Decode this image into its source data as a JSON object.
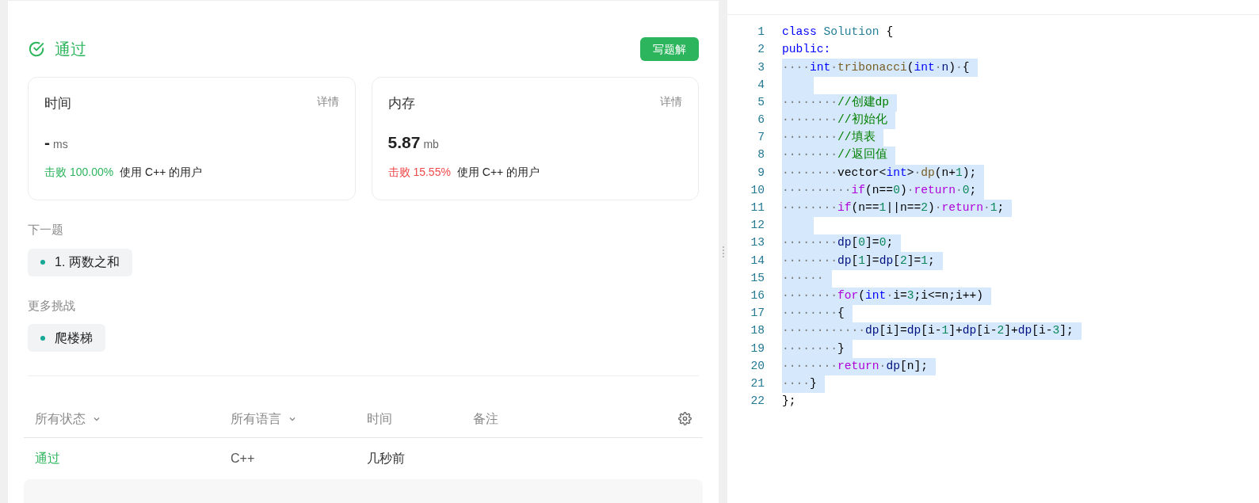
{
  "result": {
    "status": "通过",
    "button": "写题解"
  },
  "stats": [
    {
      "title": "时间",
      "link": "详情",
      "value": "-",
      "unit": "ms",
      "beat": "击败 100.00%",
      "beat_good": true,
      "note": "使用 C++ 的用户"
    },
    {
      "title": "内存",
      "link": "详情",
      "value": "5.87",
      "unit": "mb",
      "beat": "击败 15.55%",
      "beat_good": false,
      "note": "使用 C++ 的用户"
    }
  ],
  "next": {
    "heading": "下一题",
    "items": [
      "1. 两数之和"
    ]
  },
  "more": {
    "heading": "更多挑战",
    "items": [
      "爬楼梯"
    ]
  },
  "table": {
    "columns": [
      {
        "label": "所有状态",
        "dropdown": true
      },
      {
        "label": "所有语言",
        "dropdown": true
      },
      {
        "label": "时间",
        "dropdown": false
      },
      {
        "label": "备注",
        "dropdown": false
      }
    ],
    "rows": [
      {
        "status": "通过",
        "language": "C++",
        "time": "几秒前"
      }
    ]
  },
  "code": [
    {
      "number": "1",
      "selected": false,
      "tokens": [
        {
          "kind": "keyword",
          "text": "class"
        },
        {
          "kind": "type",
          "text": " Solution"
        },
        {
          "kind": "plain",
          "text": " {"
        }
      ]
    },
    {
      "number": "2",
      "selected": false,
      "tokens": [
        {
          "kind": "keyword",
          "text": "public:"
        }
      ]
    },
    {
      "number": "3",
      "selected": true,
      "tokens": [
        {
          "kind": "ws",
          "text": "····"
        },
        {
          "kind": "keyword",
          "text": "int"
        },
        {
          "kind": "ws",
          "text": "·"
        },
        {
          "kind": "func",
          "text": "tribonacci"
        },
        {
          "kind": "plain",
          "text": "("
        },
        {
          "kind": "keyword",
          "text": "int"
        },
        {
          "kind": "ws",
          "text": "·"
        },
        {
          "kind": "var",
          "text": "n"
        },
        {
          "kind": "plain",
          "text": ")"
        },
        {
          "kind": "ws",
          "text": "·"
        },
        {
          "kind": "plain",
          "text": "{"
        }
      ]
    },
    {
      "number": "4",
      "selected": true
    },
    {
      "number": "5",
      "selected": true,
      "tokens": [
        {
          "kind": "ws",
          "text": "········"
        },
        {
          "kind": "comment",
          "text": "//创建dp"
        }
      ]
    },
    {
      "number": "6",
      "selected": true,
      "tokens": [
        {
          "kind": "ws",
          "text": "········"
        },
        {
          "kind": "comment",
          "text": "//初始化"
        }
      ]
    },
    {
      "number": "7",
      "selected": true,
      "tokens": [
        {
          "kind": "ws",
          "text": "········"
        },
        {
          "kind": "comment",
          "text": "//填表"
        }
      ]
    },
    {
      "number": "8",
      "selected": true,
      "tokens": [
        {
          "kind": "ws",
          "text": "········"
        },
        {
          "kind": "comment",
          "text": "//返回值"
        }
      ]
    },
    {
      "number": "9",
      "selected": true,
      "tokens": [
        {
          "kind": "ws",
          "text": "········"
        },
        {
          "kind": "plain",
          "text": "vector<"
        },
        {
          "kind": "keyword",
          "text": "int"
        },
        {
          "kind": "plain",
          "text": ">"
        },
        {
          "kind": "ws",
          "text": "·"
        },
        {
          "kind": "func",
          "text": "dp"
        },
        {
          "kind": "plain",
          "text": "(n+"
        },
        {
          "kind": "number",
          "text": "1"
        },
        {
          "kind": "plain",
          "text": ");"
        }
      ]
    },
    {
      "number": "10",
      "selected": true,
      "tokens": [
        {
          "kind": "ws",
          "text": "··········"
        },
        {
          "kind": "control",
          "text": "if"
        },
        {
          "kind": "plain",
          "text": "(n=="
        },
        {
          "kind": "number",
          "text": "0"
        },
        {
          "kind": "plain",
          "text": ")"
        },
        {
          "kind": "ws",
          "text": "·"
        },
        {
          "kind": "control",
          "text": "return"
        },
        {
          "kind": "ws",
          "text": "·"
        },
        {
          "kind": "number",
          "text": "0"
        },
        {
          "kind": "plain",
          "text": ";"
        }
      ]
    },
    {
      "number": "11",
      "selected": true,
      "tokens": [
        {
          "kind": "ws",
          "text": "········"
        },
        {
          "kind": "control",
          "text": "if"
        },
        {
          "kind": "plain",
          "text": "(n=="
        },
        {
          "kind": "number",
          "text": "1"
        },
        {
          "kind": "plain",
          "text": "||n=="
        },
        {
          "kind": "number",
          "text": "2"
        },
        {
          "kind": "plain",
          "text": ")"
        },
        {
          "kind": "ws",
          "text": "·"
        },
        {
          "kind": "control",
          "text": "return"
        },
        {
          "kind": "ws",
          "text": "·"
        },
        {
          "kind": "number",
          "text": "1"
        },
        {
          "kind": "plain",
          "text": ";"
        }
      ]
    },
    {
      "number": "12",
      "selected": true
    },
    {
      "number": "13",
      "selected": true,
      "tokens": [
        {
          "kind": "ws",
          "text": "········"
        },
        {
          "kind": "var",
          "text": "dp"
        },
        {
          "kind": "plain",
          "text": "["
        },
        {
          "kind": "number",
          "text": "0"
        },
        {
          "kind": "plain",
          "text": "]="
        },
        {
          "kind": "number",
          "text": "0"
        },
        {
          "kind": "plain",
          "text": ";"
        }
      ]
    },
    {
      "number": "14",
      "selected": true,
      "tokens": [
        {
          "kind": "ws",
          "text": "········"
        },
        {
          "kind": "var",
          "text": "dp"
        },
        {
          "kind": "plain",
          "text": "["
        },
        {
          "kind": "number",
          "text": "1"
        },
        {
          "kind": "plain",
          "text": "]="
        },
        {
          "kind": "var",
          "text": "dp"
        },
        {
          "kind": "plain",
          "text": "["
        },
        {
          "kind": "number",
          "text": "2"
        },
        {
          "kind": "plain",
          "text": "]="
        },
        {
          "kind": "number",
          "text": "1"
        },
        {
          "kind": "plain",
          "text": ";"
        }
      ]
    },
    {
      "number": "15",
      "selected": true,
      "tokens": [
        {
          "kind": "ws",
          "text": "······"
        }
      ]
    },
    {
      "number": "16",
      "selected": true,
      "tokens": [
        {
          "kind": "ws",
          "text": "········"
        },
        {
          "kind": "control",
          "text": "for"
        },
        {
          "kind": "plain",
          "text": "("
        },
        {
          "kind": "keyword",
          "text": "int"
        },
        {
          "kind": "ws",
          "text": "·"
        },
        {
          "kind": "plain",
          "text": "i="
        },
        {
          "kind": "number",
          "text": "3"
        },
        {
          "kind": "plain",
          "text": ";i<=n;i++)"
        }
      ]
    },
    {
      "number": "17",
      "selected": true,
      "tokens": [
        {
          "kind": "ws",
          "text": "········"
        },
        {
          "kind": "plain",
          "text": "{"
        }
      ]
    },
    {
      "number": "18",
      "selected": true,
      "tokens": [
        {
          "kind": "ws",
          "text": "············"
        },
        {
          "kind": "var",
          "text": "dp"
        },
        {
          "kind": "plain",
          "text": "[i]="
        },
        {
          "kind": "var",
          "text": "dp"
        },
        {
          "kind": "plain",
          "text": "[i-"
        },
        {
          "kind": "number",
          "text": "1"
        },
        {
          "kind": "plain",
          "text": "]+"
        },
        {
          "kind": "var",
          "text": "dp"
        },
        {
          "kind": "plain",
          "text": "[i-"
        },
        {
          "kind": "number",
          "text": "2"
        },
        {
          "kind": "plain",
          "text": "]+"
        },
        {
          "kind": "var",
          "text": "dp"
        },
        {
          "kind": "plain",
          "text": "[i-"
        },
        {
          "kind": "number",
          "text": "3"
        },
        {
          "kind": "plain",
          "text": "];"
        }
      ]
    },
    {
      "number": "19",
      "selected": true,
      "tokens": [
        {
          "kind": "ws",
          "text": "········"
        },
        {
          "kind": "plain",
          "text": "}"
        }
      ]
    },
    {
      "number": "20",
      "selected": true,
      "tokens": [
        {
          "kind": "ws",
          "text": "········"
        },
        {
          "kind": "control",
          "text": "return"
        },
        {
          "kind": "ws",
          "text": "·"
        },
        {
          "kind": "var",
          "text": "dp"
        },
        {
          "kind": "plain",
          "text": "[n];"
        }
      ]
    },
    {
      "number": "21",
      "selected": true,
      "tokens": [
        {
          "kind": "ws",
          "text": "····"
        },
        {
          "kind": "plain",
          "text": "}"
        }
      ]
    },
    {
      "number": "22",
      "selected": false,
      "tokens": [
        {
          "kind": "plain",
          "text": "};"
        }
      ]
    }
  ]
}
